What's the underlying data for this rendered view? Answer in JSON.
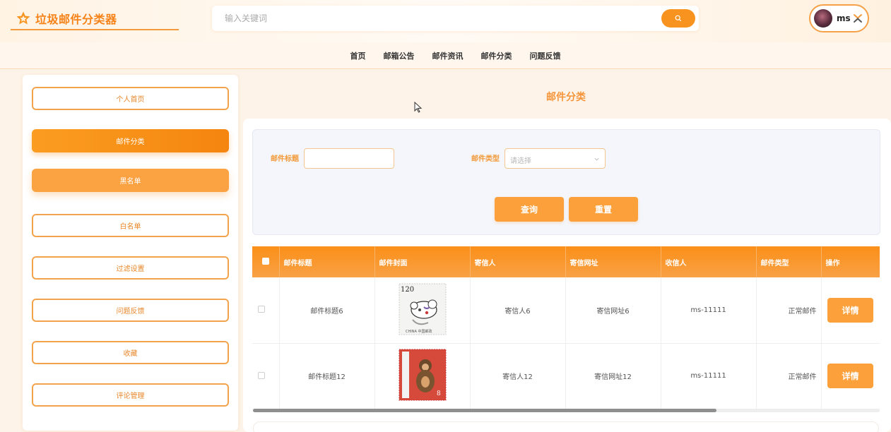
{
  "header": {
    "app_title": "垃圾邮件分类器",
    "search_placeholder": "输入关键词",
    "user_name": "ms"
  },
  "nav": {
    "items": [
      "首页",
      "邮箱公告",
      "邮件资讯",
      "邮件分类",
      "问题反馈"
    ]
  },
  "sidebar": {
    "items": [
      {
        "label": "个人首页",
        "state": "normal"
      },
      {
        "label": "邮件分类",
        "state": "active"
      },
      {
        "label": "黑名单",
        "state": "soft"
      },
      {
        "label": "白名单",
        "state": "normal"
      },
      {
        "label": "过滤设置",
        "state": "normal"
      },
      {
        "label": "问题反馈",
        "state": "normal"
      },
      {
        "label": "收藏",
        "state": "normal"
      },
      {
        "label": "评论管理",
        "state": "normal"
      }
    ]
  },
  "main": {
    "page_title": "邮件分类",
    "filter": {
      "title_label": "邮件标题",
      "title_value": "",
      "type_label": "邮件类型",
      "type_placeholder": "请选择",
      "query_button": "查询",
      "reset_button": "重置"
    },
    "table": {
      "headers": [
        "邮件标题",
        "邮件封面",
        "寄信人",
        "寄信网址",
        "收信人",
        "邮件类型",
        "操作"
      ],
      "rows": [
        {
          "title": "邮件标题6",
          "cover": "stamp-rat-icon",
          "sender": "寄信人6",
          "sender_url": "寄信网址6",
          "recipient": "ms-11111",
          "type": "正常邮件",
          "action": "详情"
        },
        {
          "title": "邮件标题12",
          "cover": "stamp-monkey-icon",
          "sender": "寄信人12",
          "sender_url": "寄信网址12",
          "recipient": "ms-11111",
          "type": "正常邮件",
          "action": "详情"
        }
      ]
    },
    "stamp1_value": "120",
    "stamp1_caption": "CHINA 中国邮政",
    "stamp2_value": "8"
  },
  "colors": {
    "accent": "#f7931e",
    "accent_soft": "#fba03a",
    "label": "#f29a3a"
  }
}
